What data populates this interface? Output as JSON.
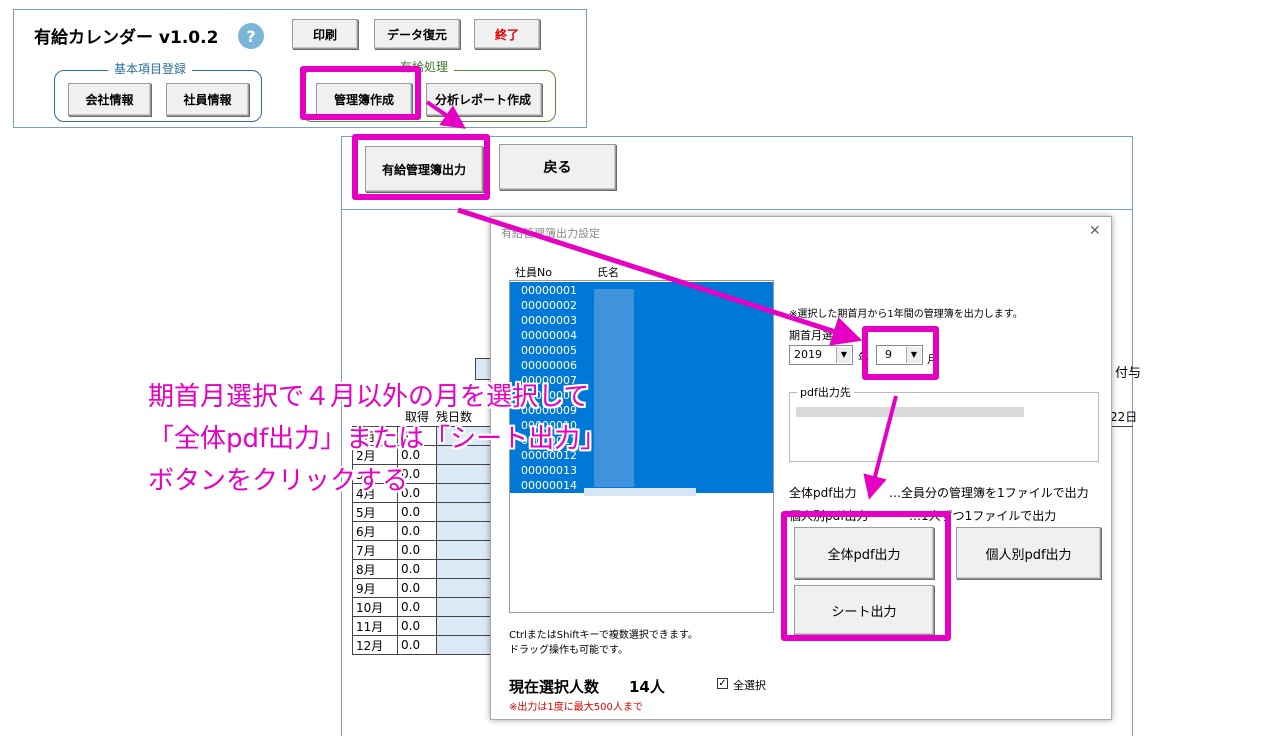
{
  "top_panel": {
    "app_title": "有給カレンダー v1.0.2",
    "help": "?",
    "print_button": "印刷",
    "restore_button": "データ復元",
    "exit_button": "終了",
    "basic_group_title": "基本項目登録",
    "company_button": "会社情報",
    "employee_button": "社員情報",
    "paid_group_title": "有給処理",
    "ledger_button": "管理簿作成",
    "report_button": "分析レポート作成"
  },
  "sheet": {
    "output_button": "有給管理簿出力",
    "back_button": "戻る",
    "header_fragments": [
      "取得",
      "残日数"
    ],
    "right_header": "付与",
    "right_date": "22日",
    "months": [
      {
        "month": "1月",
        "value": "0.0"
      },
      {
        "month": "2月",
        "value": "0.0"
      },
      {
        "month": "3月",
        "value": "0.0"
      },
      {
        "month": "4月",
        "value": "0.0"
      },
      {
        "month": "5月",
        "value": "0.0"
      },
      {
        "month": "6月",
        "value": "0.0"
      },
      {
        "month": "7月",
        "value": "0.0"
      },
      {
        "month": "8月",
        "value": "0.0"
      },
      {
        "month": "9月",
        "value": "0.0"
      },
      {
        "month": "10月",
        "value": "0.0"
      },
      {
        "month": "11月",
        "value": "0.0"
      },
      {
        "month": "12月",
        "value": "0.0"
      }
    ]
  },
  "dialog": {
    "title": "有給管理簿出力設定",
    "close": "✕",
    "col_no": "社員No",
    "col_name": "氏名",
    "employees": [
      "00000001",
      "00000002",
      "00000003",
      "00000004",
      "00000005",
      "00000006",
      "00000007",
      "00000008",
      "00000009",
      "00000010",
      "00000011",
      "00000012",
      "00000013",
      "00000014"
    ],
    "note": "※選択した期首月から1年間の管理簿を出力します。",
    "period_label": "期首月選択",
    "year_value": "2019",
    "year_suffix": "年",
    "month_value": "9",
    "month_suffix": "月",
    "pdf_dest_label": "pdf出力先",
    "all_pdf_desc_label": "全体pdf出力",
    "all_pdf_desc": "…全員分の管理簿を1ファイルで出力",
    "indiv_pdf_desc_label": "個人別pdf出力",
    "indiv_pdf_desc": "…1人ずつ1ファイルで出力",
    "all_pdf_button": "全体pdf出力",
    "indiv_pdf_button": "個人別pdf出力",
    "sheet_button": "シート出力",
    "hint1": "CtrlまたはShiftキーで複数選択できます。",
    "hint2": "ドラッグ操作も可能です。",
    "count_label": "現在選択人数",
    "count_value": "14人",
    "select_all_label": "全選択",
    "limit_note": "※出力は1度に最大500人まで"
  },
  "annotation": {
    "line1": "期首月選択で４月以外の月を選択して",
    "line2": "「全体pdf出力」または「シート出力」",
    "line3": "ボタンをクリックする"
  },
  "colors": {
    "highlight": "#e600c4",
    "selection": "#0078d7",
    "group_border": "#2a6f9e"
  }
}
